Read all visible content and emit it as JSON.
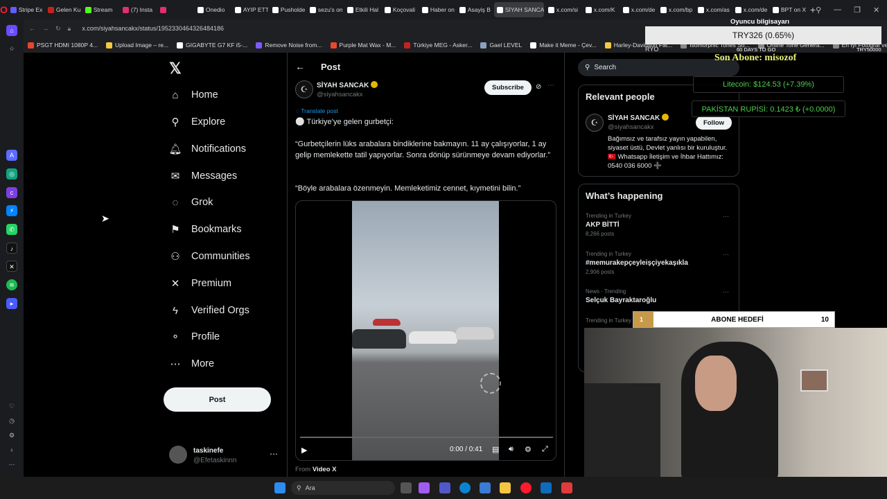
{
  "browser": {
    "tabs": [
      {
        "label": "Stripe Ex",
        "color": "#635bff"
      },
      {
        "label": "Gelen Ku",
        "color": "#c5221f"
      },
      {
        "label": "Stream",
        "color": "#53fc18"
      },
      {
        "label": "(7) Insta",
        "color": "#e1306c"
      },
      {
        "label": "",
        "color": "#e1306c"
      },
      {
        "label": "Onedio",
        "color": "#ffffff"
      },
      {
        "label": "AYIP ETT",
        "color": "#ffffff"
      },
      {
        "label": "Pusholde",
        "color": "#ffffff"
      },
      {
        "label": "sezu's on",
        "color": "#ffffff"
      },
      {
        "label": "Etkili Hal",
        "color": "#ffffff"
      },
      {
        "label": "Koçovali",
        "color": "#ffffff"
      },
      {
        "label": "Haber on",
        "color": "#ffffff"
      },
      {
        "label": "Asayiş B",
        "color": "#ffffff"
      },
      {
        "label": "SİYAH SANCAK",
        "color": "#ffffff",
        "active": true
      },
      {
        "label": "x.com/si",
        "color": "#ffffff"
      },
      {
        "label": "x.com/K",
        "color": "#ffffff"
      },
      {
        "label": "x.com/de",
        "color": "#ffffff"
      },
      {
        "label": "x.com/bp",
        "color": "#ffffff"
      },
      {
        "label": "x.com/as",
        "color": "#ffffff"
      },
      {
        "label": "x.com/de",
        "color": "#ffffff"
      },
      {
        "label": "BPT on X",
        "color": "#ffffff"
      }
    ],
    "url": "x.com/siyahsancakx/status/1952330464326484186",
    "bookmarks": [
      {
        "label": "PSGT HDMI 1080P 4...",
        "color": "#e8472e"
      },
      {
        "label": "Upload Image – re...",
        "color": "#f5c842"
      },
      {
        "label": "GIGABYTE G7 KF i5-...",
        "color": "#ffffff"
      },
      {
        "label": "Remove Noise from...",
        "color": "#7b5cff"
      },
      {
        "label": "Purple Mat Wax - M...",
        "color": "#e8472e"
      },
      {
        "label": "Türkiye MEG - Asker...",
        "color": "#c5221f"
      },
      {
        "label": "Gael LEVEL",
        "color": "#8aa0c0"
      },
      {
        "label": "Make it Meme - Çev...",
        "color": "#ffffff"
      },
      {
        "label": "Harley-Davidson Fat...",
        "color": "#f5c842"
      },
      {
        "label": "Isomorphic Tones So...",
        "color": "#888888"
      },
      {
        "label": "Online Tone Genera...",
        "color": "#888888"
      },
      {
        "label": "En İyi Fotoğraf ve Vi...",
        "color": "#888888"
      }
    ]
  },
  "nav": {
    "items": [
      {
        "label": "Home",
        "icon": "⌂",
        "name": "home"
      },
      {
        "label": "Explore",
        "icon": "⚲",
        "name": "explore"
      },
      {
        "label": "Notifications",
        "icon": "🔔︎",
        "name": "notifications"
      },
      {
        "label": "Messages",
        "icon": "✉",
        "name": "messages"
      },
      {
        "label": "Grok",
        "icon": "◌",
        "name": "grok"
      },
      {
        "label": "Bookmarks",
        "icon": "⚑",
        "name": "bookmarks"
      },
      {
        "label": "Communities",
        "icon": "⚇",
        "name": "communities"
      },
      {
        "label": "Premium",
        "icon": "✕",
        "name": "premium"
      },
      {
        "label": "Verified Orgs",
        "icon": "ϟ",
        "name": "verified-orgs"
      },
      {
        "label": "Profile",
        "icon": "⚬",
        "name": "profile"
      },
      {
        "label": "More",
        "icon": "⋯",
        "name": "more"
      }
    ],
    "post_label": "Post",
    "account": {
      "name": "taskinefe",
      "handle": "@Efetaskinnn"
    }
  },
  "post": {
    "header": "Post",
    "author": {
      "name": "SİYAH SANCAK",
      "handle": "@siyahsancakx"
    },
    "subscribe_label": "Subscribe",
    "translate_label": "Translate post",
    "paragraphs": [
      "⚪ Türkiye’ye gelen gurbetçi:",
      "“Gurbetçilerin lüks arabalara bindiklerine bakmayın. 11 ay çalışıyorlar, 1 ay gelip memlekette tatil yapıyorlar. Sonra dönüp sürünmeye devam ediyorlar.”",
      "“Böyle arabalara özenmeyin. Memleketimiz cennet, kıymetini bilin.”"
    ],
    "video": {
      "time": "0:00 / 0:41",
      "progress": 0.0
    },
    "from_prefix": "From",
    "from_source": "Video X"
  },
  "right": {
    "search_placeholder": "Search",
    "relevant": {
      "heading": "Relevant people",
      "name": "SİYAH SANCAK",
      "handle": "@siyahsancakx",
      "follow_label": "Follow",
      "bio": "Bağımsız ve tarafsız yayın yapabilen, siyaset üstü, Devlet yanlısı bir kuruluştur. 🇹🇷 Whatsapp İletişim ve İhbar Hattımız: 0540 036 6000 ➕"
    },
    "happening": {
      "heading": "What’s happening",
      "trends": [
        {
          "meta": "Trending in Turkey",
          "title": "AKP BİTTİ",
          "count": "8,266 posts"
        },
        {
          "meta": "Trending in Turkey",
          "title": "#memurakepçeyleişçiyekaşıkla",
          "count": "2,906 posts"
        },
        {
          "meta": "News · Trending",
          "title": "Selçuk Bayraktaroğlu",
          "count": ""
        },
        {
          "meta": "Trending in Turkey",
          "title": "",
          "count": ""
        }
      ]
    }
  },
  "overlay": {
    "top_label": "Oyuncu bilgisayarı",
    "try_value": "TRY326 (0.65%)",
    "ryo": "RYO",
    "days": "60 DAYS TO GO",
    "try_goal": "TRY50000",
    "son_abone": "Son Abone: misozof",
    "litecoin": "Litecoin: $124.53 (+7.39%)",
    "pakistan": "PAKİSTAN RUPİSİ: 0.1423 ₺ (+0.0000)",
    "abone_current": "1",
    "abone_label": "ABONE HEDEFİ",
    "abone_goal": "10",
    "abone_progress": 0.1
  },
  "taskbar": {
    "search_label": "Ara"
  }
}
